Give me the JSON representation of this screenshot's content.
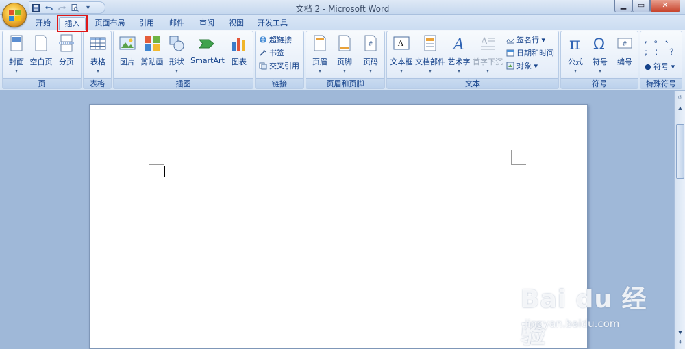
{
  "window": {
    "title": "文档 2 - Microsoft Word"
  },
  "qat": {
    "save": "save-icon",
    "undo": "undo-icon",
    "redo": "redo-icon",
    "preview": "print-preview-icon",
    "more": "▾"
  },
  "tabs": [
    {
      "label": "开始"
    },
    {
      "label": "插入"
    },
    {
      "label": "页面布局"
    },
    {
      "label": "引用"
    },
    {
      "label": "邮件"
    },
    {
      "label": "审阅"
    },
    {
      "label": "视图"
    },
    {
      "label": "开发工具"
    }
  ],
  "ribbon": {
    "pages": {
      "label": "页",
      "cover": "封面",
      "blank": "空白页",
      "break": "分页"
    },
    "tables": {
      "label": "表格",
      "table": "表格"
    },
    "illustrations": {
      "label": "插图",
      "picture": "图片",
      "clipart": "剪贴画",
      "shapes": "形状",
      "smartart": "SmartArt",
      "chart": "图表"
    },
    "links": {
      "label": "链接",
      "hyperlink": "超链接",
      "bookmark": "书签",
      "crossref": "交叉引用"
    },
    "headerfooter": {
      "label": "页眉和页脚",
      "header": "页眉",
      "footer": "页脚",
      "pagenum": "页码"
    },
    "text": {
      "label": "文本",
      "textbox": "文本框",
      "quickparts": "文档部件",
      "wordart": "艺术字",
      "dropcap": "首字下沉",
      "sigline": "签名行",
      "datetime": "日期和时间",
      "object": "对象"
    },
    "symbols": {
      "label": "符号",
      "equation": "公式",
      "symbol": "符号",
      "numbering": "编号"
    },
    "special": {
      "label": "特殊符号",
      "symbol": "符号",
      "chars": [
        ",",
        "。",
        "、",
        ";",
        "：",
        "？"
      ]
    }
  },
  "dropdown_marker": "▾",
  "watermark": {
    "brand": "Bai du 经验",
    "url": "jingyan.baidu.com"
  },
  "colors": {
    "accent": "#15428b",
    "highlight": "#e01818",
    "ribbon_bg": "#dfe9f6",
    "workspace": "#9fb8d8"
  }
}
